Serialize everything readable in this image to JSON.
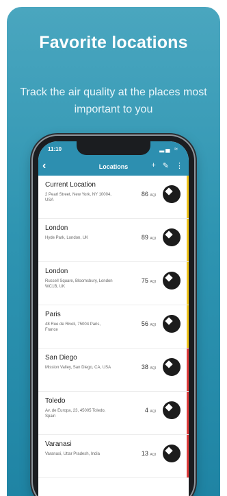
{
  "headline": "Favorite locations",
  "subline": "Track the air quality at the places most important to you",
  "status": {
    "time": "11:10",
    "icons_text": "▂▄ ≈"
  },
  "navbar": {
    "back": "‹",
    "title": "Locations",
    "actions": [
      "+",
      "✎",
      "⋮"
    ]
  },
  "aqi_unit": "AQI",
  "locations": [
    {
      "name": "Current Location",
      "address": "2 Pearl Street, New York, NY 10004, USA",
      "aqi": "86",
      "color": "#f0c419"
    },
    {
      "name": "London",
      "address": "Hyde Park, London, UK",
      "aqi": "89",
      "color": "#f0c419"
    },
    {
      "name": "London",
      "address": "Russell Square, Bloomsbury, London WC1B, UK",
      "aqi": "75",
      "color": "#f0c419"
    },
    {
      "name": "Paris",
      "address": "48 Rue de Rivoli, 75004 Paris, France",
      "aqi": "56",
      "color": "#f0c419"
    },
    {
      "name": "San Diego",
      "address": "Mission Valley, San Diego, CA, USA",
      "aqi": "38",
      "color": "#e03b3b"
    },
    {
      "name": "Toledo",
      "address": "Av. de Europa, 23, 45005 Toledo, Spain",
      "aqi": "4",
      "color": "#e03b3b"
    },
    {
      "name": "Varanasi",
      "address": "Varanasi, Uttar Pradesh, India",
      "aqi": "13",
      "color": "#e03b3b"
    }
  ]
}
